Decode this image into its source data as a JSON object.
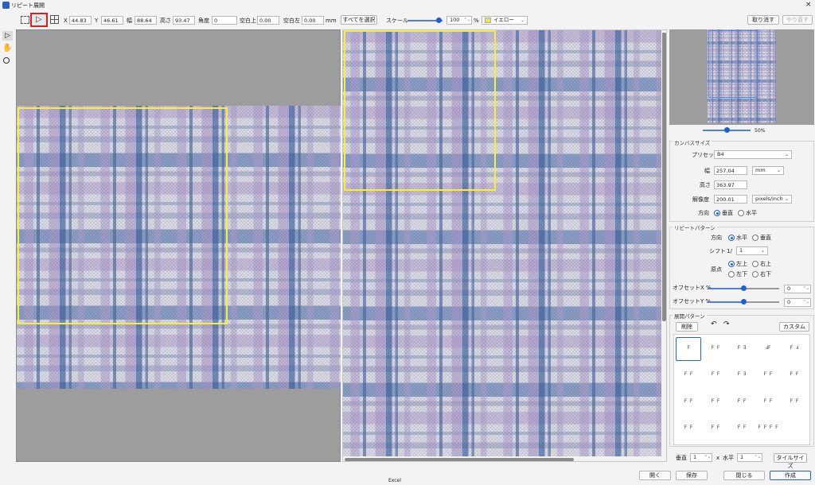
{
  "window": {
    "title": "リピート展開",
    "close_glyph": "×",
    "app_icon": "app-icon"
  },
  "toolbar": {
    "x_label": "X",
    "x_value": "44.83",
    "y_label": "Y",
    "y_value": "46.61",
    "w_label": "幅",
    "w_value": "88.64",
    "h_label": "高さ",
    "h_value": "93.47",
    "angle_label": "角度",
    "angle_value": "0",
    "margin_top_label": "空白上",
    "margin_top_value": "0.00",
    "margin_left_label": "空白左",
    "margin_left_value": "0.00",
    "unit": "mm",
    "select_all": "すべてを選択",
    "scale_label": "スケール",
    "scale_fraction": 0.9,
    "scale_value": "100",
    "percent": "%",
    "color_label": "イエロー",
    "color_swatch": "#f5e43c",
    "undo": "取り消す",
    "redo": "やり直す"
  },
  "tools": [
    "select-arrow-icon",
    "hand-icon",
    "zoom-icon"
  ],
  "preview": {
    "zoom_fraction": 0.5,
    "zoom_label": "50%"
  },
  "canvas_size": {
    "title": "カンバスサイズ",
    "preset_label": "プリセット",
    "preset_value": "B4",
    "width_label": "幅",
    "width_value": "257.04",
    "width_unit": "mm",
    "height_label": "高さ",
    "height_value": "363.97",
    "resolution_label": "解像度",
    "resolution_value": "200.01",
    "resolution_unit": "pixels/inch",
    "direction_label": "方向",
    "direction_vertical": "垂直",
    "direction_horizontal": "水平"
  },
  "repeat_pattern": {
    "title": "リピートパターン",
    "direction_label": "方向",
    "dir_horizontal": "水平",
    "dir_vertical": "垂直",
    "shift_label": "シフト",
    "shift_prefix": "1/",
    "shift_value": "1",
    "origin_label": "原点",
    "origin_top_left": "左上",
    "origin_top_right": "右上",
    "origin_bottom_left": "左下",
    "origin_bottom_right": "右下",
    "offset_x_label": "オフセットX %",
    "offset_x_fraction": 0.5,
    "offset_x_value": "0",
    "offset_y_label": "オフセットY %",
    "offset_y_fraction": 0.5,
    "offset_y_value": "0"
  },
  "expand_pattern": {
    "title": "展開パターン",
    "delete": "削除",
    "custom": "カスタム",
    "cells": [
      "F",
      "F F",
      "F ∃",
      "ℲF",
      "F Ⅎ",
      "F F",
      "F F",
      "F ∃",
      "F F",
      "F F",
      "F F",
      "F F",
      "F F",
      "F F",
      "F F",
      "F F",
      "F F",
      "F F",
      "F F F F"
    ]
  },
  "tile": {
    "vertical_label": "垂直",
    "vertical_value": "1",
    "times": "x",
    "horizontal_label": "水平",
    "horizontal_value": "1",
    "tile_size": "タイルサイズ"
  },
  "footer": {
    "open": "開く",
    "save": "保存",
    "close": "閉じる",
    "create": "作成",
    "taskbar_label": "Excel"
  },
  "colors": {
    "accent": "#1e5fd2",
    "selection": "#f7ef3a",
    "highlight_box": "#e02020",
    "gray_bg": "#9d9d9d"
  }
}
